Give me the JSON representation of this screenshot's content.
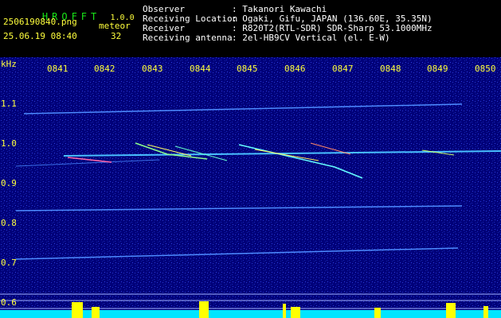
{
  "app": {
    "name": "HROFFT",
    "version": "1.0.0"
  },
  "file": {
    "name": "2506190840.png",
    "datetime": "25.06.19 08:40"
  },
  "meteor": {
    "label": "meteor",
    "count": "32"
  },
  "info": [
    {
      "key": "Observer",
      "value": ": Takanori Kawachi"
    },
    {
      "key": "Receiving Location",
      "value": ": Ogaki, Gifu, JAPAN (136.60E, 35.35N)"
    },
    {
      "key": "Receiver",
      "value": ": R820T2(RTL-SDR) SDR-Sharp 53.1000MHz"
    },
    {
      "key": "Receiving antenna",
      "value": ": 2el-HB9CV Vertical (el. E-W)"
    }
  ],
  "axis": {
    "unit": "kHz",
    "time_ticks": [
      "0841",
      "0842",
      "0843",
      "0844",
      "0845",
      "0846",
      "0847",
      "0848",
      "0849",
      "0850"
    ],
    "freq_ticks": [
      "1.1",
      "1.0",
      "0.9",
      "0.8",
      "0.7",
      "0.6"
    ]
  },
  "colors": {
    "header_green": "#19e619",
    "label_yellow": "#ffff3c",
    "background": "#000080",
    "signal": "#00ffff"
  }
}
